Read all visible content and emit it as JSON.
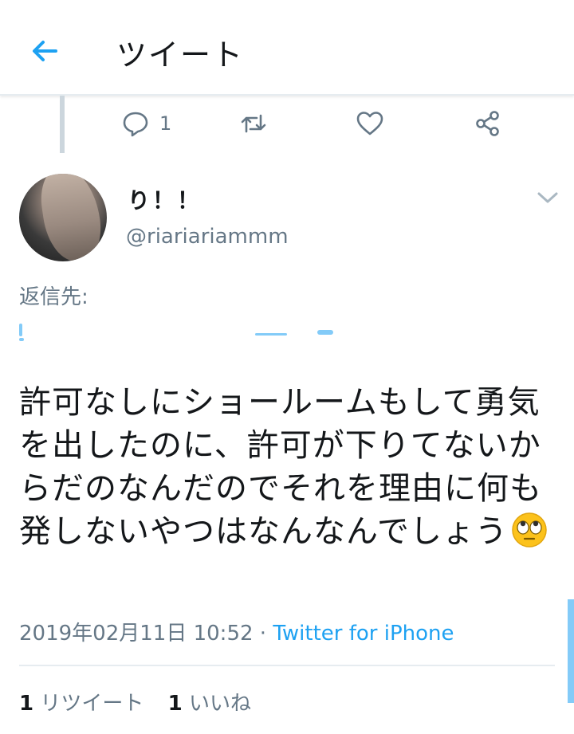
{
  "header": {
    "title": "ツイート",
    "back_icon": "back-arrow-icon"
  },
  "actions": {
    "reply_count": "1",
    "retweet_count": "",
    "like_count": "",
    "colors": {
      "icon": "#657786"
    }
  },
  "author": {
    "display_name": "り！！",
    "handle": "@riariariammm"
  },
  "reply_to": {
    "label": "返信先:"
  },
  "tweet": {
    "text": "許可なしにショールームもして勇気を出したのに、許可が下りてないからだのなんだのでそれを理由に何も発しないやつはなんなんでしょう",
    "emoji": "face-with-rolling-eyes"
  },
  "meta": {
    "timestamp": "2019年02月11日 10:52",
    "separator": " · ",
    "source": "Twitter for iPhone"
  },
  "stats": {
    "retweets_count": "1",
    "retweets_label": "リツイート",
    "likes_count": "1",
    "likes_label": "いいね"
  },
  "colors": {
    "accent": "#1da1f2",
    "text": "#14171a",
    "muted": "#657786",
    "divider": "#e6ecf0"
  }
}
